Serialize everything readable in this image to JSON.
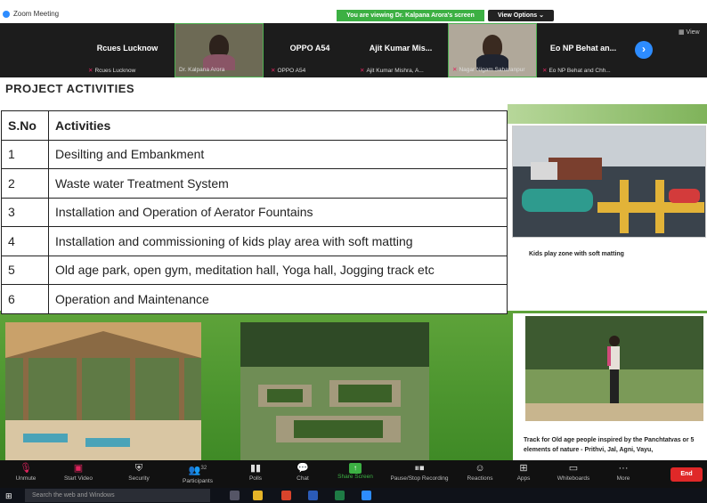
{
  "window": {
    "title": "Zoom Meeting"
  },
  "banner": {
    "viewing_text": "You are viewing Dr. Kalpana Arora's screen",
    "view_options_label": "View Options ⌄"
  },
  "gallery": {
    "view_toggle_label": "▦ View",
    "tiles": [
      {
        "display_name": "Rcues Lucknow",
        "label": "Rcues Lucknow"
      },
      {
        "display_name": "",
        "label": "Dr. Kalpana Arora"
      },
      {
        "display_name": "OPPO A54",
        "label": "OPPO A54"
      },
      {
        "display_name": "Ajit Kumar Mis...",
        "label": "Ajit Kumar Mishra, A..."
      },
      {
        "display_name": "",
        "label": "Nagar Nigam Saharanpur"
      },
      {
        "display_name": "Eo NP Behat an...",
        "label": "Eo NP Behat and Chh..."
      }
    ],
    "next_icon": "›"
  },
  "slide": {
    "heading": "PROJECT ACTIVITIES",
    "table": {
      "headers": [
        "S.No",
        "Activities"
      ],
      "rows": [
        [
          "1",
          "Desilting and Embankment"
        ],
        [
          "2",
          "Waste water Treatment System"
        ],
        [
          "3",
          "Installation and Operation of Aerator Fountains"
        ],
        [
          "4",
          "Installation and commissioning of kids play area with soft matting"
        ],
        [
          "5",
          "Old age park, open gym, meditation hall, Yoga hall, Jogging track etc"
        ],
        [
          "6",
          "Operation and Maintenance"
        ]
      ]
    },
    "captions": {
      "play": "Kids play zone with soft matting",
      "track": "Track for Old age people inspired by the Panchtatvas or 5 elements of nature - Prithvi, Jal, Agni, Vayu,"
    }
  },
  "toolbar": {
    "unmute": "Unmute",
    "start_video": "Start Video",
    "security": "Security",
    "participants": "Participants",
    "participants_count": "32",
    "polls": "Polls",
    "chat": "Chat",
    "share_screen": "Share Screen",
    "recording": "Pause/Stop Recording",
    "reactions": "Reactions",
    "apps": "Apps",
    "whiteboards": "Whiteboards",
    "more": "More",
    "end": "End"
  },
  "taskbar": {
    "search_placeholder": "Search the web and Windows"
  },
  "colors": {
    "zoom_blue": "#2d8cff",
    "share_green": "#3cb043",
    "end_red": "#e02828"
  }
}
